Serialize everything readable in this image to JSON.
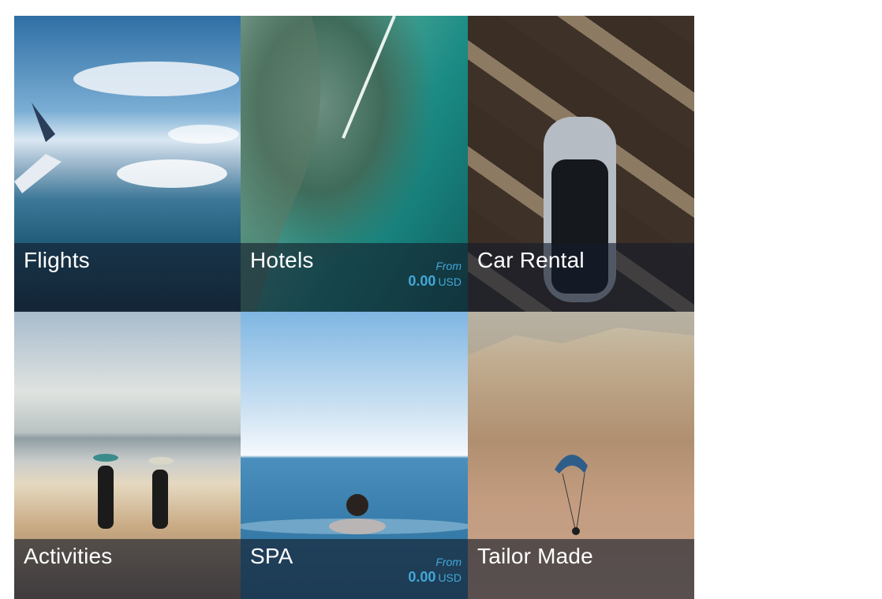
{
  "tiles": [
    {
      "name": "Flights",
      "show_price": false
    },
    {
      "name": "Hotels",
      "show_price": true,
      "price_from": "From",
      "price_amount": "0.00",
      "price_currency": "USD"
    },
    {
      "name": "Car Rental",
      "show_price": false
    },
    {
      "name": "Activities",
      "show_price": false
    },
    {
      "name": "SPA",
      "show_price": true,
      "price_from": "From",
      "price_amount": "0.00",
      "price_currency": "USD"
    },
    {
      "name": "Tailor Made",
      "show_price": false
    }
  ],
  "colors": {
    "overlay": "#141b2a",
    "price_accent": "#42a8d8",
    "title_text": "#ffffff"
  }
}
